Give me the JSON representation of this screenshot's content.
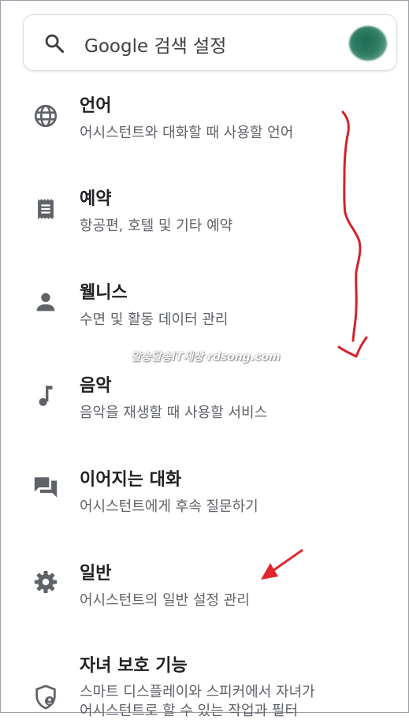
{
  "search": {
    "placeholder": "Google 검색 설정",
    "icon": "search-icon"
  },
  "settings_items": [
    {
      "title": "언어",
      "subtitle": "어시스턴트와 대화할 때 사용할 언어",
      "icon": "globe-icon"
    },
    {
      "title": "예약",
      "subtitle": "항공편, 호텔 및 기타 예약",
      "icon": "receipt-icon"
    },
    {
      "title": "웰니스",
      "subtitle": "수면 및 활동 데이터 관리",
      "icon": "person-icon"
    },
    {
      "title": "음악",
      "subtitle": "음악을 재생할 때 사용할 서비스",
      "icon": "music-note-icon"
    },
    {
      "title": "이어지는 대화",
      "subtitle": "어시스턴트에게 후속 질문하기",
      "icon": "chat-bubbles-icon"
    },
    {
      "title": "일반",
      "subtitle": "어시스턴트의 일반 설정 관리",
      "icon": "gear-icon"
    },
    {
      "title": "자녀 보호 기능",
      "subtitle": "스마트 디스플레이와 스피커에서 자녀가",
      "subtitle2": "어시스턴트로 할 수 있는 작업과 필터",
      "icon": "shield-person-icon"
    }
  ],
  "watermark": "알송달송IT세상 rdsong.com",
  "annotation_colors": {
    "squiggle_arrow": "#d3222a",
    "pointer_arrow": "#e0262c"
  }
}
